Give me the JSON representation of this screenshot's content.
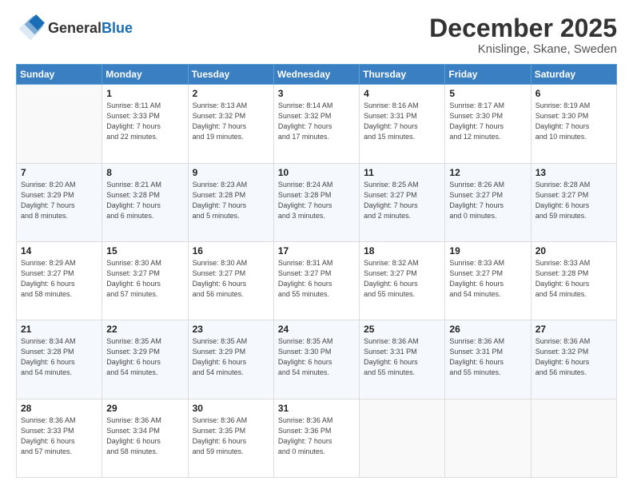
{
  "header": {
    "logo_general": "General",
    "logo_blue": "Blue",
    "month_title": "December 2025",
    "subtitle": "Knislinge, Skane, Sweden"
  },
  "days_header": [
    "Sunday",
    "Monday",
    "Tuesday",
    "Wednesday",
    "Thursday",
    "Friday",
    "Saturday"
  ],
  "weeks": [
    [
      {
        "day": "",
        "info": ""
      },
      {
        "day": "1",
        "info": "Sunrise: 8:11 AM\nSunset: 3:33 PM\nDaylight: 7 hours\nand 22 minutes."
      },
      {
        "day": "2",
        "info": "Sunrise: 8:13 AM\nSunset: 3:32 PM\nDaylight: 7 hours\nand 19 minutes."
      },
      {
        "day": "3",
        "info": "Sunrise: 8:14 AM\nSunset: 3:32 PM\nDaylight: 7 hours\nand 17 minutes."
      },
      {
        "day": "4",
        "info": "Sunrise: 8:16 AM\nSunset: 3:31 PM\nDaylight: 7 hours\nand 15 minutes."
      },
      {
        "day": "5",
        "info": "Sunrise: 8:17 AM\nSunset: 3:30 PM\nDaylight: 7 hours\nand 12 minutes."
      },
      {
        "day": "6",
        "info": "Sunrise: 8:19 AM\nSunset: 3:30 PM\nDaylight: 7 hours\nand 10 minutes."
      }
    ],
    [
      {
        "day": "7",
        "info": "Sunrise: 8:20 AM\nSunset: 3:29 PM\nDaylight: 7 hours\nand 8 minutes."
      },
      {
        "day": "8",
        "info": "Sunrise: 8:21 AM\nSunset: 3:28 PM\nDaylight: 7 hours\nand 6 minutes."
      },
      {
        "day": "9",
        "info": "Sunrise: 8:23 AM\nSunset: 3:28 PM\nDaylight: 7 hours\nand 5 minutes."
      },
      {
        "day": "10",
        "info": "Sunrise: 8:24 AM\nSunset: 3:28 PM\nDaylight: 7 hours\nand 3 minutes."
      },
      {
        "day": "11",
        "info": "Sunrise: 8:25 AM\nSunset: 3:27 PM\nDaylight: 7 hours\nand 2 minutes."
      },
      {
        "day": "12",
        "info": "Sunrise: 8:26 AM\nSunset: 3:27 PM\nDaylight: 7 hours\nand 0 minutes."
      },
      {
        "day": "13",
        "info": "Sunrise: 8:28 AM\nSunset: 3:27 PM\nDaylight: 6 hours\nand 59 minutes."
      }
    ],
    [
      {
        "day": "14",
        "info": "Sunrise: 8:29 AM\nSunset: 3:27 PM\nDaylight: 6 hours\nand 58 minutes."
      },
      {
        "day": "15",
        "info": "Sunrise: 8:30 AM\nSunset: 3:27 PM\nDaylight: 6 hours\nand 57 minutes."
      },
      {
        "day": "16",
        "info": "Sunrise: 8:30 AM\nSunset: 3:27 PM\nDaylight: 6 hours\nand 56 minutes."
      },
      {
        "day": "17",
        "info": "Sunrise: 8:31 AM\nSunset: 3:27 PM\nDaylight: 6 hours\nand 55 minutes."
      },
      {
        "day": "18",
        "info": "Sunrise: 8:32 AM\nSunset: 3:27 PM\nDaylight: 6 hours\nand 55 minutes."
      },
      {
        "day": "19",
        "info": "Sunrise: 8:33 AM\nSunset: 3:27 PM\nDaylight: 6 hours\nand 54 minutes."
      },
      {
        "day": "20",
        "info": "Sunrise: 8:33 AM\nSunset: 3:28 PM\nDaylight: 6 hours\nand 54 minutes."
      }
    ],
    [
      {
        "day": "21",
        "info": "Sunrise: 8:34 AM\nSunset: 3:28 PM\nDaylight: 6 hours\nand 54 minutes."
      },
      {
        "day": "22",
        "info": "Sunrise: 8:35 AM\nSunset: 3:29 PM\nDaylight: 6 hours\nand 54 minutes."
      },
      {
        "day": "23",
        "info": "Sunrise: 8:35 AM\nSunset: 3:29 PM\nDaylight: 6 hours\nand 54 minutes."
      },
      {
        "day": "24",
        "info": "Sunrise: 8:35 AM\nSunset: 3:30 PM\nDaylight: 6 hours\nand 54 minutes."
      },
      {
        "day": "25",
        "info": "Sunrise: 8:36 AM\nSunset: 3:31 PM\nDaylight: 6 hours\nand 55 minutes."
      },
      {
        "day": "26",
        "info": "Sunrise: 8:36 AM\nSunset: 3:31 PM\nDaylight: 6 hours\nand 55 minutes."
      },
      {
        "day": "27",
        "info": "Sunrise: 8:36 AM\nSunset: 3:32 PM\nDaylight: 6 hours\nand 56 minutes."
      }
    ],
    [
      {
        "day": "28",
        "info": "Sunrise: 8:36 AM\nSunset: 3:33 PM\nDaylight: 6 hours\nand 57 minutes."
      },
      {
        "day": "29",
        "info": "Sunrise: 8:36 AM\nSunset: 3:34 PM\nDaylight: 6 hours\nand 58 minutes."
      },
      {
        "day": "30",
        "info": "Sunrise: 8:36 AM\nSunset: 3:35 PM\nDaylight: 6 hours\nand 59 minutes."
      },
      {
        "day": "31",
        "info": "Sunrise: 8:36 AM\nSunset: 3:36 PM\nDaylight: 7 hours\nand 0 minutes."
      },
      {
        "day": "",
        "info": ""
      },
      {
        "day": "",
        "info": ""
      },
      {
        "day": "",
        "info": ""
      }
    ]
  ]
}
